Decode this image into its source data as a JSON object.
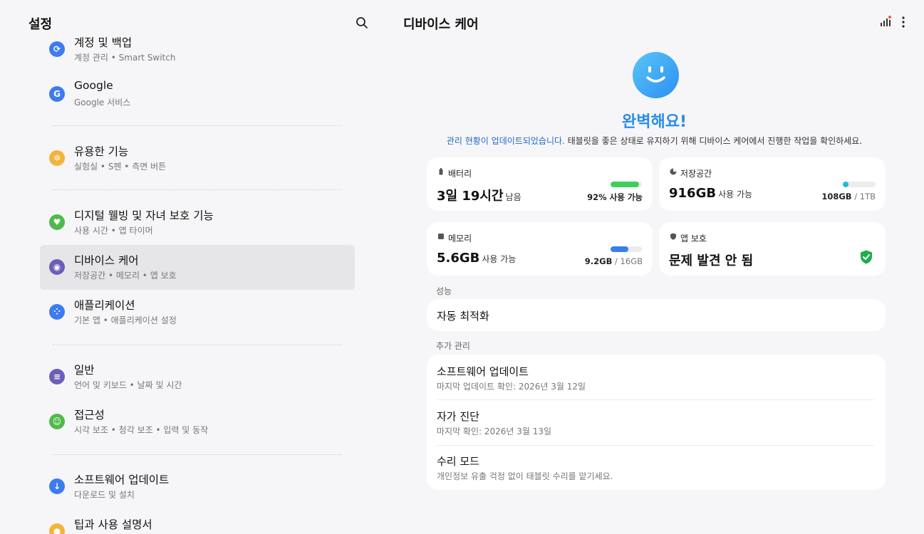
{
  "left": {
    "title": "설정",
    "items": [
      {
        "title": "계정 및 백업",
        "subtitle": "계정 관리 • Smart Switch",
        "icon": "sync-icon",
        "color": "#3d7cf0"
      },
      {
        "title": "Google",
        "subtitle": "Google 서비스",
        "icon": "google-icon",
        "color": "#3d7cf0"
      },
      {
        "title": "유용한 기능",
        "subtitle": "실험실 • S펜 • 측면 버튼",
        "icon": "star-gear-icon",
        "color": "#f3b43a"
      },
      {
        "title": "디지털 웰빙 및 자녀 보호 기능",
        "subtitle": "사용 시간 • 앱 타이머",
        "icon": "heart-icon",
        "color": "#4fba4a"
      },
      {
        "title": "디바이스 케어",
        "subtitle": "저장공간 • 메모리 • 앱 보호",
        "icon": "device-care-icon",
        "color": "#6d5fb8"
      },
      {
        "title": "애플리케이션",
        "subtitle": "기본 앱 • 애플리케이션 설정",
        "icon": "apps-icon",
        "color": "#3d7cf0"
      },
      {
        "title": "일반",
        "subtitle": "언어 및 키보드 • 날짜 및 시간",
        "icon": "sliders-icon",
        "color": "#6d5fb8"
      },
      {
        "title": "접근성",
        "subtitle": "시각 보조 • 청각 보조 • 입력 및 동작",
        "icon": "accessibility-icon",
        "color": "#4fba4a"
      },
      {
        "title": "소프트웨어 업데이트",
        "subtitle": "다운로드 및 설치",
        "icon": "update-icon",
        "color": "#3d7cf0"
      },
      {
        "title": "팁과 사용 설명서",
        "subtitle": "",
        "icon": "bulb-icon",
        "color": "#f3b43a"
      }
    ]
  },
  "right": {
    "title": "디바이스 케어",
    "status": "완벽해요!",
    "desc_link": "관리 현황이 업데이트되었습니다.",
    "desc_text": " 태블릿을 좋은 상태로 유지하기 위해 디바이스 케어에서 진행한 작업을 확인하세요.",
    "battery": {
      "label": "배터리",
      "value": "3일 19시간",
      "unit": "남음",
      "meta": "92% 사용 가능",
      "fraction": 0.92,
      "color": "#3ecf5a"
    },
    "storage": {
      "label": "저장공간",
      "value": "916GB",
      "unit": "사용 가능",
      "used": "108GB",
      "total": " / 1TB",
      "fraction": 0.108,
      "color": "#1fb8dc"
    },
    "memory": {
      "label": "메모리",
      "value": "5.6GB",
      "unit": "사용 가능",
      "used": "9.2GB",
      "total": " / 16GB",
      "fraction": 0.575,
      "color": "#3b7cef"
    },
    "app_protect": {
      "label": "앱 보호",
      "value": "문제 발견 안 됨",
      "color": "#1fae4b"
    },
    "performance_label": "성능",
    "auto_optimize": "자동 최적화",
    "more_label": "추가 관리",
    "more_items": [
      {
        "title": "소프트웨어 업데이트",
        "subtitle": "마지막 업데이트 확인: 2026년 3월 12일"
      },
      {
        "title": "자가 진단",
        "subtitle": "마지막 확인: 2026년 3월 13일"
      },
      {
        "title": "수리 모드",
        "subtitle": "개인정보 유출 걱정 없이 태블릿 수리를 맡기세요."
      }
    ]
  }
}
